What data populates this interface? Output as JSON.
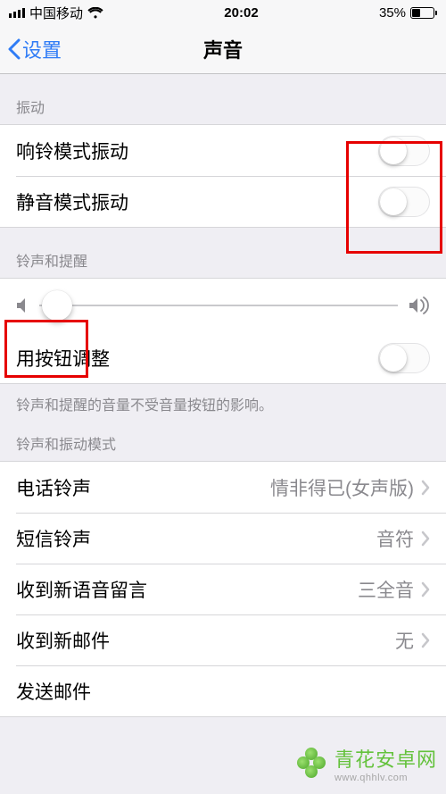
{
  "status": {
    "carrier": "中国移动",
    "time": "20:02",
    "battery_pct": "35%"
  },
  "nav": {
    "back_label": "设置",
    "title": "声音"
  },
  "sections": {
    "vibrate_header": "振动",
    "ringtone_alert_header": "铃声和提醒",
    "button_adjust_note": "铃声和提醒的音量不受音量按钮的影响。",
    "ringtone_patterns_header": "铃声和振动模式"
  },
  "rows": {
    "vibrate_ring": {
      "label": "响铃模式振动",
      "on": false
    },
    "vibrate_silent": {
      "label": "静音模式振动",
      "on": false
    },
    "button_adjust": {
      "label": "用按钮调整",
      "on": false
    },
    "ringtone": {
      "label": "电话铃声",
      "value": "情非得已(女声版)"
    },
    "text_tone": {
      "label": "短信铃声",
      "value": "音符"
    },
    "voicemail": {
      "label": "收到新语音留言",
      "value": "三全音"
    },
    "new_mail": {
      "label": "收到新邮件",
      "value": "无"
    },
    "sent_mail": {
      "label": "发送邮件",
      "value": ""
    }
  },
  "slider": {
    "position_pct": 5
  },
  "watermark": {
    "brand": "青花安卓网",
    "url": "www.qhhlv.com"
  }
}
